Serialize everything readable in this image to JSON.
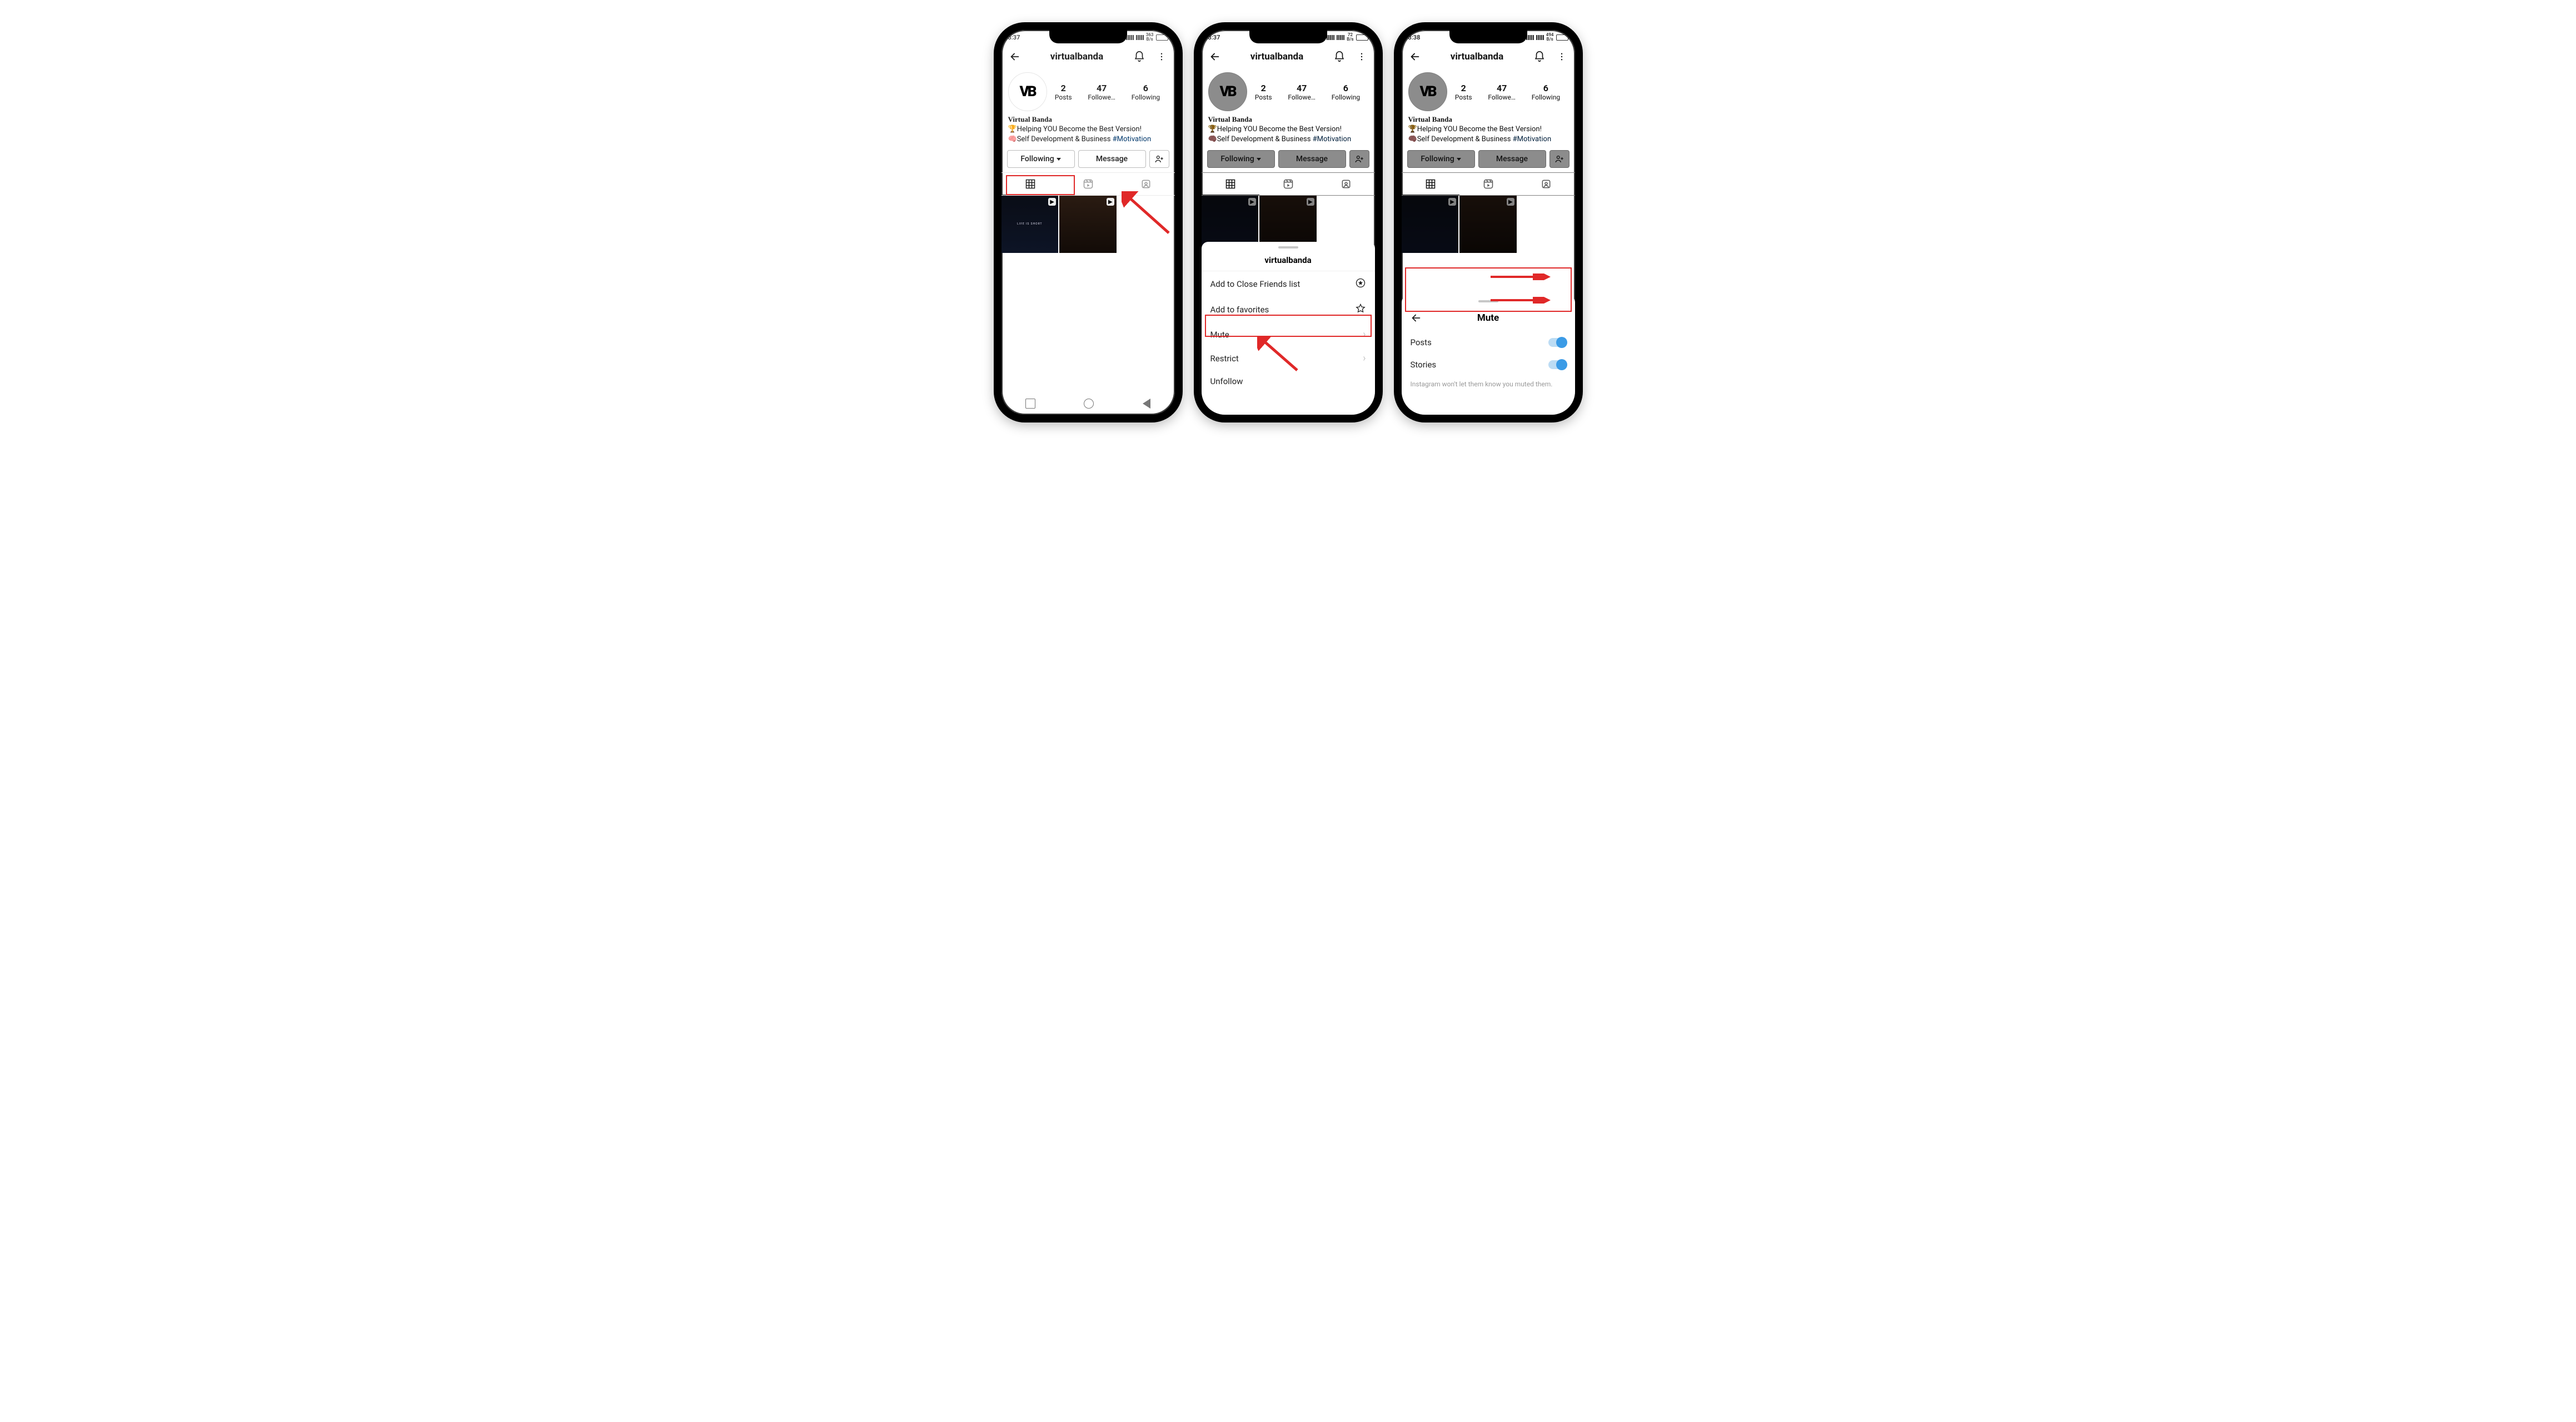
{
  "colors": {
    "highlight": "#e02828",
    "link": "#00376b",
    "switch": "#3b9be6"
  },
  "status": {
    "p1": {
      "time": "3:37",
      "kbps": "363",
      "kbps_unit": "B/s"
    },
    "p2": {
      "time": "3:37",
      "kbps": "72",
      "kbps_unit": "B/s"
    },
    "p3": {
      "time": "3:38",
      "kbps": "494",
      "kbps_unit": "B/s"
    }
  },
  "profile": {
    "username": "virtualbanda",
    "display_name": "Virtual Banda",
    "avatar_text": "VB",
    "bio_line1_emoji": "🏆",
    "bio_line1": "Helping YOU Become the Best Version!",
    "bio_line2_emoji": "🧠",
    "bio_line2": "Self Development & Business ",
    "bio_tag": "#Motivation",
    "stats": {
      "posts": {
        "count": "2",
        "label": "Posts"
      },
      "followers": {
        "count": "47",
        "label": "Followe…"
      },
      "following": {
        "count": "6",
        "label": "Following"
      }
    },
    "buttons": {
      "following": "Following",
      "message": "Message"
    },
    "thumb1_caption": "LIFE IS SHORT"
  },
  "sheet1": {
    "title": "virtualbanda",
    "items": {
      "close_friends": "Add to Close Friends list",
      "favorites": "Add to favorites",
      "mute": "Mute",
      "restrict": "Restrict",
      "unfollow": "Unfollow"
    }
  },
  "sheet2": {
    "title": "Mute",
    "posts": "Posts",
    "stories": "Stories",
    "note": "Instagram won't let them know you muted them."
  }
}
